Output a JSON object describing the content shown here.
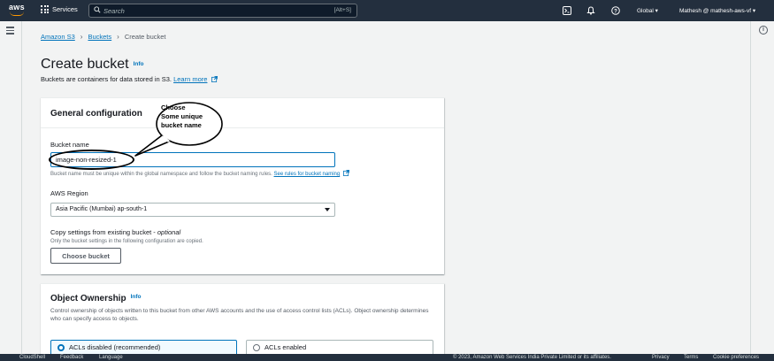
{
  "topnav": {
    "brand": "aws",
    "services_label": "Services",
    "search_placeholder": "Search",
    "search_shortcut": "[Alt+S]",
    "region": "Global ▾",
    "account": "Mathesh @ mathesh-aws-vf ▾"
  },
  "breadcrumb": {
    "items": [
      "Amazon S3",
      "Buckets"
    ],
    "current": "Create bucket"
  },
  "page": {
    "title": "Create bucket",
    "info": "Info",
    "description": "Buckets are containers for data stored in S3.",
    "learn_more": "Learn more"
  },
  "general": {
    "title": "General configuration",
    "bucket_name_label": "Bucket name",
    "bucket_name_value": "image-non-resized-1",
    "bucket_hint": "Bucket name must be unique within the global namespace and follow the bucket naming rules.",
    "bucket_hint_link": "See rules for bucket naming",
    "region_label": "AWS Region",
    "region_value": "Asia Pacific (Mumbai) ap-south-1",
    "copy_label": "Copy settings from existing bucket - ",
    "copy_label_optional": "optional",
    "copy_hint": "Only the bucket settings in the following configuration are copied.",
    "choose_bucket": "Choose bucket"
  },
  "annotation": {
    "lines": [
      "Choose",
      "Some unique",
      "bucket name"
    ]
  },
  "ownership": {
    "title": "Object Ownership",
    "info": "Info",
    "description": "Control ownership of objects written to this bucket from other AWS accounts and the use of access control lists (ACLs). Object ownership determines who can specify access to objects.",
    "option_disabled": "ACLs disabled (recommended)",
    "option_enabled": "ACLs enabled",
    "selected": "ACLs disabled (recommended)"
  },
  "footer": {
    "cloudshell": "CloudShell",
    "feedback": "Feedback",
    "language": "Language",
    "copyright": "© 2023, Amazon Web Services India Private Limited or its affiliates.",
    "privacy": "Privacy",
    "terms": "Terms",
    "cookies": "Cookie preferences"
  },
  "colors": {
    "nav_bg": "#232f3e",
    "link": "#0073bb",
    "accent": "#ff9900"
  },
  "icons": [
    "grid-icon",
    "search-icon",
    "cloudshell-icon",
    "bell-icon",
    "help-icon",
    "settings-icon",
    "hamburger-icon",
    "info-icon",
    "external-link-icon",
    "caret-down-icon"
  ]
}
